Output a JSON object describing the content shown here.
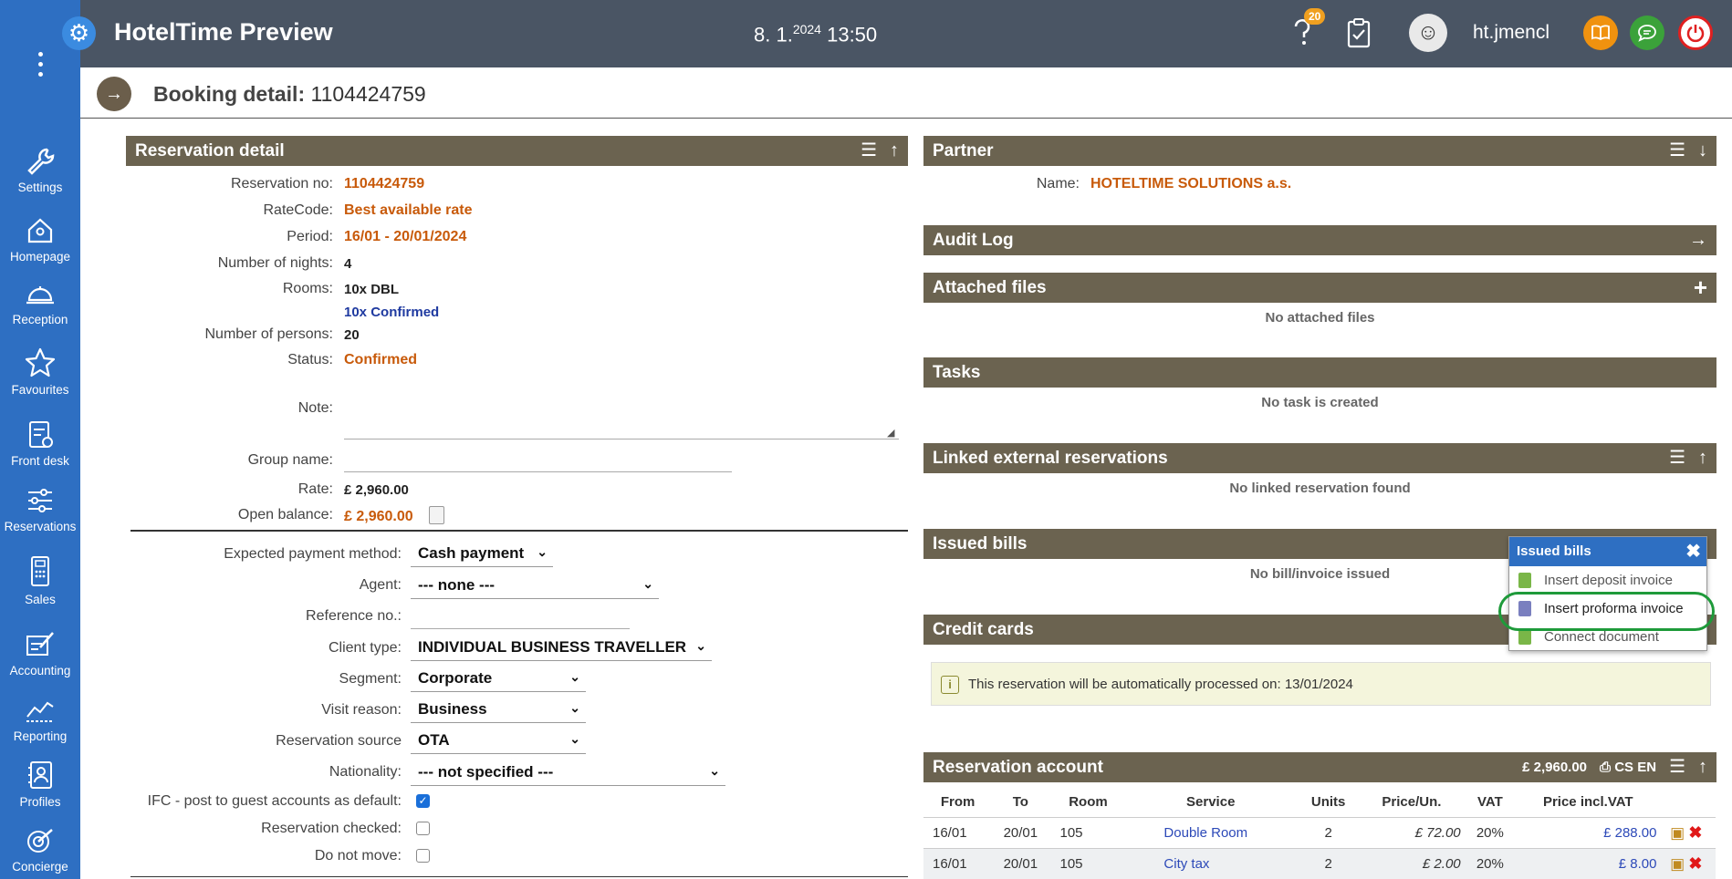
{
  "app": {
    "title": "HotelTime Preview",
    "date": "8. 1.",
    "date_sup": "2024",
    "time": "13:50",
    "help_badge": "20",
    "username": "ht.jmencl"
  },
  "sidebar": {
    "items": [
      {
        "label": "Settings",
        "icon": "wrench-icon"
      },
      {
        "label": "Homepage",
        "icon": "home-icon"
      },
      {
        "label": "Reception",
        "icon": "bell-icon"
      },
      {
        "label": "Favourites",
        "icon": "star-icon"
      },
      {
        "label": "Front desk",
        "icon": "clipboard-icon"
      },
      {
        "label": "Reservations",
        "icon": "sliders-icon"
      },
      {
        "label": "Sales",
        "icon": "calculator-icon"
      },
      {
        "label": "Accounting",
        "icon": "accounting-icon"
      },
      {
        "label": "Reporting",
        "icon": "chart-icon"
      },
      {
        "label": "Profiles",
        "icon": "profiles-icon"
      },
      {
        "label": "Concierge",
        "icon": "concierge-icon"
      }
    ]
  },
  "page": {
    "title_bold": "Booking detail:",
    "title_num": "1104424759"
  },
  "reservation": {
    "header": "Reservation detail",
    "reservation_no_label": "Reservation no:",
    "reservation_no": "1104424759",
    "ratecode_label": "RateCode:",
    "ratecode": "Best available rate",
    "period_label": "Period:",
    "period": "16/01 - 20/01/2024",
    "nights_label": "Number of nights:",
    "nights": "4",
    "rooms_label": "Rooms:",
    "rooms": "10x DBL",
    "rooms_status": "10x Confirmed",
    "persons_label": "Number of persons:",
    "persons": "20",
    "status_label": "Status:",
    "status": "Confirmed",
    "note_label": "Note:",
    "group_label": "Group name:",
    "rate_label": "Rate:",
    "rate": "£ 2,960.00",
    "balance_label": "Open balance:",
    "balance": "£ 2,960.00",
    "payment_label": "Expected payment method:",
    "payment": "Cash payment",
    "agent_label": "Agent:",
    "agent": "--- none ---",
    "ref_label": "Reference no.:",
    "client_label": "Client type:",
    "client": "INDIVIDUAL BUSINESS TRAVELLER",
    "segment_label": "Segment:",
    "segment": "Corporate",
    "visit_label": "Visit reason:",
    "visit": "Business",
    "source_label": "Reservation source",
    "source": "OTA",
    "nationality_label": "Nationality:",
    "nationality": "--- not specified ---",
    "ifc_label": "IFC - post to guest accounts as default:",
    "checked_label": "Reservation checked:",
    "nomove_label": "Do not move:"
  },
  "partner": {
    "header": "Partner",
    "name_label": "Name:",
    "name": "HOTELTIME SOLUTIONS a.s."
  },
  "audit": {
    "header": "Audit Log"
  },
  "files": {
    "header": "Attached files",
    "empty": "No attached files"
  },
  "tasks": {
    "header": "Tasks",
    "empty": "No task is created"
  },
  "linked": {
    "header": "Linked external reservations",
    "empty": "No linked reservation found"
  },
  "bills": {
    "header": "Issued bills",
    "empty": "No bill/invoice issued"
  },
  "popup": {
    "title": "Issued bills",
    "items": [
      "Insert deposit invoice",
      "Insert proforma invoice",
      "Connect document"
    ]
  },
  "cards": {
    "header": "Credit cards"
  },
  "notice": {
    "text": "This reservation will be automatically processed on: 13/01/2024"
  },
  "account": {
    "header": "Reservation account",
    "total": "£ 2,960.00",
    "lang": "CS EN",
    "columns": [
      "From",
      "To",
      "Room",
      "Service",
      "Units",
      "Price/Un.",
      "VAT",
      "Price incl.VAT"
    ],
    "rows": [
      {
        "from": "16/01",
        "to": "20/01",
        "room": "105",
        "service": "Double Room",
        "units": "2",
        "price": "£ 72.00",
        "vat": "20%",
        "total": "£ 288.00"
      },
      {
        "from": "16/01",
        "to": "20/01",
        "room": "105",
        "service": "City tax",
        "units": "2",
        "price": "£ 2.00",
        "vat": "20%",
        "total": "£ 8.00"
      }
    ]
  },
  "colors": {
    "sidebar": "#2e6fc2",
    "topbar": "#4a5564",
    "panel_header": "#6b6350",
    "accent_orange": "#c85a0a"
  }
}
